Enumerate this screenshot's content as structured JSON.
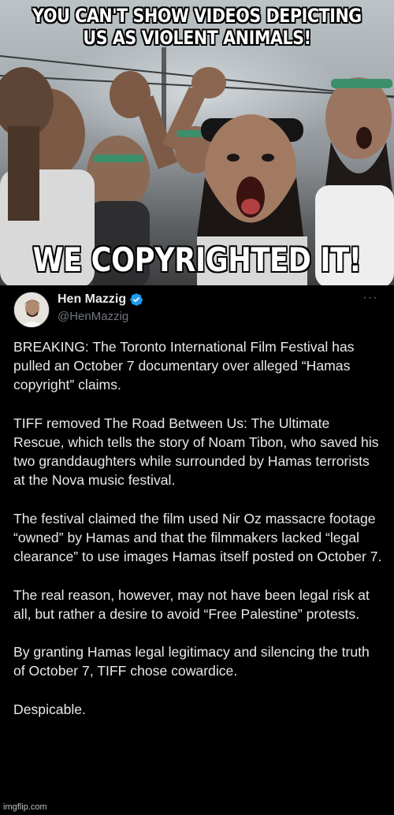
{
  "meme": {
    "top_text": "YOU CAN'T SHOW VIDEOS DEPICTING US AS VIOLENT ANIMALS!",
    "bottom_text": "WE COPYRIGHTED IT!",
    "watermark": "imgflip.com"
  },
  "tweet": {
    "display_name": "Hen Mazzig",
    "handle": "@HenMazzig",
    "verified": true,
    "more_icon": "more-horizontal-icon",
    "paragraphs": [
      "BREAKING: The Toronto International Film Festival has pulled an October 7 documentary over alleged “Hamas copyright” claims.",
      "TIFF removed The Road Between Us: The Ultimate Rescue, which tells the story of Noam Tibon, who saved his two granddaughters while surrounded by Hamas terrorists at the Nova music festival.",
      "The festival claimed the film used Nir Oz massacre footage “owned” by Hamas and that the filmmakers lacked “legal clearance” to use images Hamas itself posted on October 7.",
      "The real reason, however, may not have been legal risk at all, but rather a desire to avoid “Free Palestine” protests.",
      "By granting Hamas legal legitimacy and silencing the truth of October 7, TIFF chose cowardice.",
      "Despicable."
    ]
  },
  "colors": {
    "background": "#000000",
    "text_primary": "#e7e9ea",
    "text_secondary": "#71767b",
    "verified_blue": "#1d9bf0",
    "meme_text": "#ffffff"
  }
}
